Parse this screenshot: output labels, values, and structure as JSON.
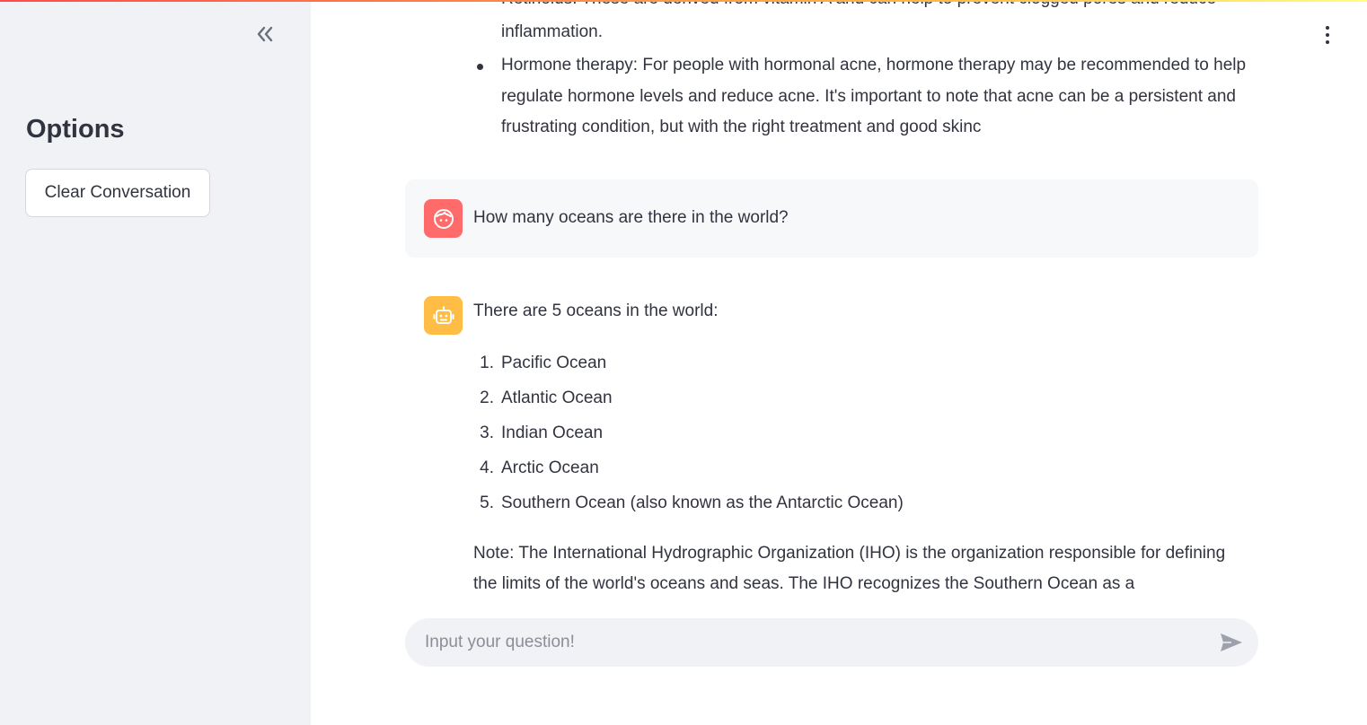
{
  "sidebar": {
    "title": "Options",
    "clear_button": "Clear Conversation"
  },
  "conversation": {
    "previous_bot": {
      "cut_line": "Retinoids: These are derived from vitamin A and can help to prevent clogged pores and reduce",
      "cut_line_end": "inflammation.",
      "bullet": "Hormone therapy: For people with hormonal acne, hormone therapy may be recommended to help regulate hormone levels and reduce acne. It's important to note that acne can be a persistent and frustrating condition, but with the right treatment and good skinc"
    },
    "user_message": "How many oceans are there in the world?",
    "bot_reply": {
      "intro": "There are 5 oceans in the world:",
      "oceans": [
        {
          "num": "1.",
          "name": "Pacific Ocean"
        },
        {
          "num": "2.",
          "name": "Atlantic Ocean"
        },
        {
          "num": "3.",
          "name": "Indian Ocean"
        },
        {
          "num": "4.",
          "name": "Arctic Ocean"
        },
        {
          "num": "5.",
          "name": "Southern Ocean (also known as the Antarctic Ocean)"
        }
      ],
      "note": "Note: The International Hydrographic Organization (IHO) is the organization responsible for defining the limits of the world's oceans and seas. The IHO recognizes the Southern Ocean as a"
    }
  },
  "input": {
    "placeholder": "Input your question!",
    "value": ""
  },
  "icons": {
    "collapse": "double-chevron-left-icon",
    "menu": "vertical-dots-icon",
    "user_avatar": "face-icon",
    "bot_avatar": "robot-icon",
    "send": "send-arrow-icon"
  },
  "colors": {
    "user_avatar": "#ff6b6b",
    "bot_avatar": "#ffbd45",
    "sidebar_bg": "#f0f2f6",
    "accent": "#ff4b4b"
  }
}
